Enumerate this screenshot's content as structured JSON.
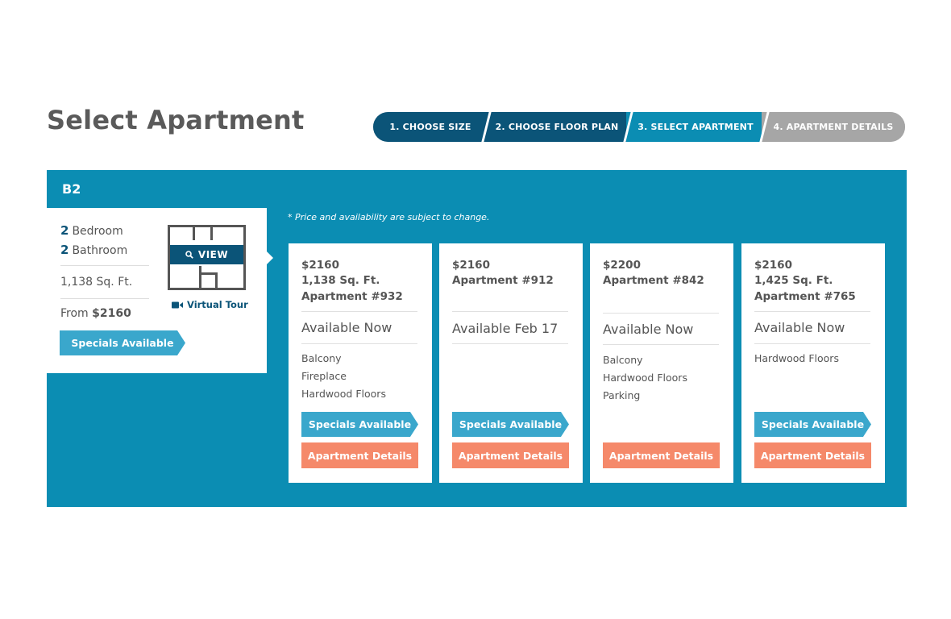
{
  "page_title": "Select Apartment",
  "stepper": [
    {
      "label": "1. CHOOSE SIZE",
      "state": "done"
    },
    {
      "label": "2. CHOOSE FLOOR PLAN",
      "state": "done"
    },
    {
      "label": "3. SELECT APARTMENT",
      "state": "current"
    },
    {
      "label": "4. APARTMENT DETAILS",
      "state": "todo"
    }
  ],
  "plan": {
    "name": "B2",
    "bedrooms_count": "2",
    "bedrooms_label": "Bedroom",
    "bathrooms_count": "2",
    "bathrooms_label": "Bathroom",
    "sqft": "1,138 Sq. Ft.",
    "from_label": "From",
    "from_price": "$2160",
    "view_label": "VIEW",
    "virtual_tour_label": "Virtual Tour",
    "specials_label": "Specials Available"
  },
  "disclaimer": "* Price and availability are subject to change.",
  "cards": [
    {
      "price": "$2160",
      "sqft": "1,138 Sq. Ft.",
      "apartment": "Apartment #932",
      "availability": "Available Now",
      "features": [
        "Balcony",
        "Fireplace",
        "Hardwood Floors"
      ],
      "specials": "Specials Available",
      "details": "Apartment Details"
    },
    {
      "price": "$2160",
      "sqft": "",
      "apartment": "Apartment #912",
      "availability": "Available Feb 17",
      "features": [],
      "specials": "Specials Available",
      "details": "Apartment Details"
    },
    {
      "price": "$2200",
      "sqft": "",
      "apartment": "Apartment #842",
      "availability": "Available Now",
      "features": [
        "Balcony",
        "Hardwood Floors",
        "Parking"
      ],
      "specials": "",
      "details": "Apartment Details"
    },
    {
      "price": "$2160",
      "sqft": "1,425 Sq. Ft.",
      "apartment": "Apartment #765",
      "availability": "Available Now",
      "features": [
        "Hardwood Floors"
      ],
      "specials": "Specials Available",
      "details": "Apartment Details"
    }
  ],
  "colors": {
    "primary_dark": "#0b5478",
    "primary": "#0b8db3",
    "specials": "#3aa7cc",
    "details": "#f5896a",
    "inactive_step": "#a6a6a6"
  }
}
